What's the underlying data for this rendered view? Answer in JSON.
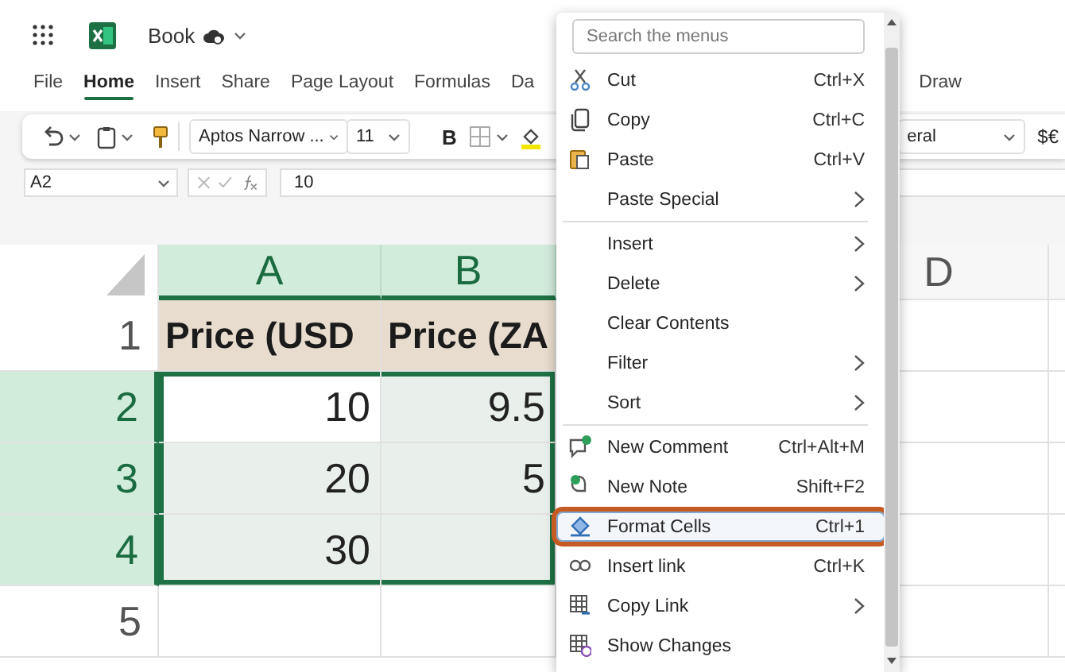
{
  "app": {
    "title": "Book"
  },
  "ribbon": {
    "tabs": [
      {
        "label": "File",
        "selected": false
      },
      {
        "label": "Home",
        "selected": true
      },
      {
        "label": "Insert",
        "selected": false
      },
      {
        "label": "Share",
        "selected": false
      },
      {
        "label": "Page Layout",
        "selected": false
      },
      {
        "label": "Formulas",
        "selected": false
      },
      {
        "label": "Da",
        "selected": false
      }
    ],
    "right_tabs": [
      {
        "label": "Draw",
        "selected": false
      }
    ]
  },
  "toolbar": {
    "font": "Aptos Narrow ...",
    "font_size": "11",
    "bold": "B",
    "number_format": "eral",
    "currency": "$€"
  },
  "formula_bar": {
    "name_box": "A2",
    "value": "10"
  },
  "sheet": {
    "columns": [
      {
        "label": "A",
        "selected": true
      },
      {
        "label": "B",
        "selected": true
      },
      {
        "label": "D",
        "selected": false
      }
    ],
    "rows": [
      {
        "label": "1",
        "selected": false,
        "kind": "header",
        "cells": [
          {
            "value": "Price (USD",
            "active": false
          },
          {
            "value": "Price (ZA",
            "active": false
          }
        ]
      },
      {
        "label": "2",
        "selected": true,
        "kind": "data",
        "cells": [
          {
            "value": "10",
            "active": true
          },
          {
            "value": "9.5",
            "active": false
          }
        ]
      },
      {
        "label": "3",
        "selected": true,
        "kind": "data",
        "cells": [
          {
            "value": "20",
            "active": false
          },
          {
            "value": "5",
            "active": false
          }
        ]
      },
      {
        "label": "4",
        "selected": true,
        "kind": "data",
        "cells": [
          {
            "value": "30",
            "active": false
          }
        ]
      },
      {
        "label": "5",
        "selected": false,
        "kind": "data"
      }
    ]
  },
  "context_menu": {
    "search": {
      "placeholder": "Search the menus"
    },
    "items": [
      {
        "kind": "item",
        "label": "Cut",
        "shortcut": "Ctrl+X",
        "submenu": false,
        "highlighted": false
      },
      {
        "kind": "item",
        "label": "Copy",
        "shortcut": "Ctrl+C",
        "submenu": false,
        "highlighted": false
      },
      {
        "kind": "item",
        "label": "Paste",
        "shortcut": "Ctrl+V",
        "submenu": false,
        "highlighted": false
      },
      {
        "kind": "item",
        "label": "Paste Special",
        "submenu": true,
        "highlighted": false
      },
      {
        "kind": "separator"
      },
      {
        "kind": "item",
        "label": "Insert",
        "submenu": true,
        "highlighted": false
      },
      {
        "kind": "item",
        "label": "Delete",
        "submenu": true,
        "highlighted": false
      },
      {
        "kind": "item",
        "label": "Clear Contents",
        "submenu": false,
        "highlighted": false
      },
      {
        "kind": "item",
        "label": "Filter",
        "submenu": true,
        "highlighted": false
      },
      {
        "kind": "item",
        "label": "Sort",
        "submenu": true,
        "highlighted": false
      },
      {
        "kind": "separator"
      },
      {
        "kind": "item",
        "label": "New Comment",
        "shortcut": "Ctrl+Alt+M",
        "submenu": false,
        "highlighted": false
      },
      {
        "kind": "item",
        "label": "New Note",
        "shortcut": "Shift+F2",
        "submenu": false,
        "highlighted": false
      },
      {
        "kind": "item",
        "label": "Format Cells",
        "shortcut": "Ctrl+1",
        "submenu": false,
        "highlighted": true
      },
      {
        "kind": "item",
        "label": "Insert link",
        "shortcut": "Ctrl+K",
        "submenu": false,
        "highlighted": false
      },
      {
        "kind": "item",
        "label": "Copy Link",
        "submenu": true,
        "highlighted": false
      },
      {
        "kind": "item",
        "label": "Show Changes",
        "submenu": false,
        "highlighted": false
      }
    ]
  }
}
